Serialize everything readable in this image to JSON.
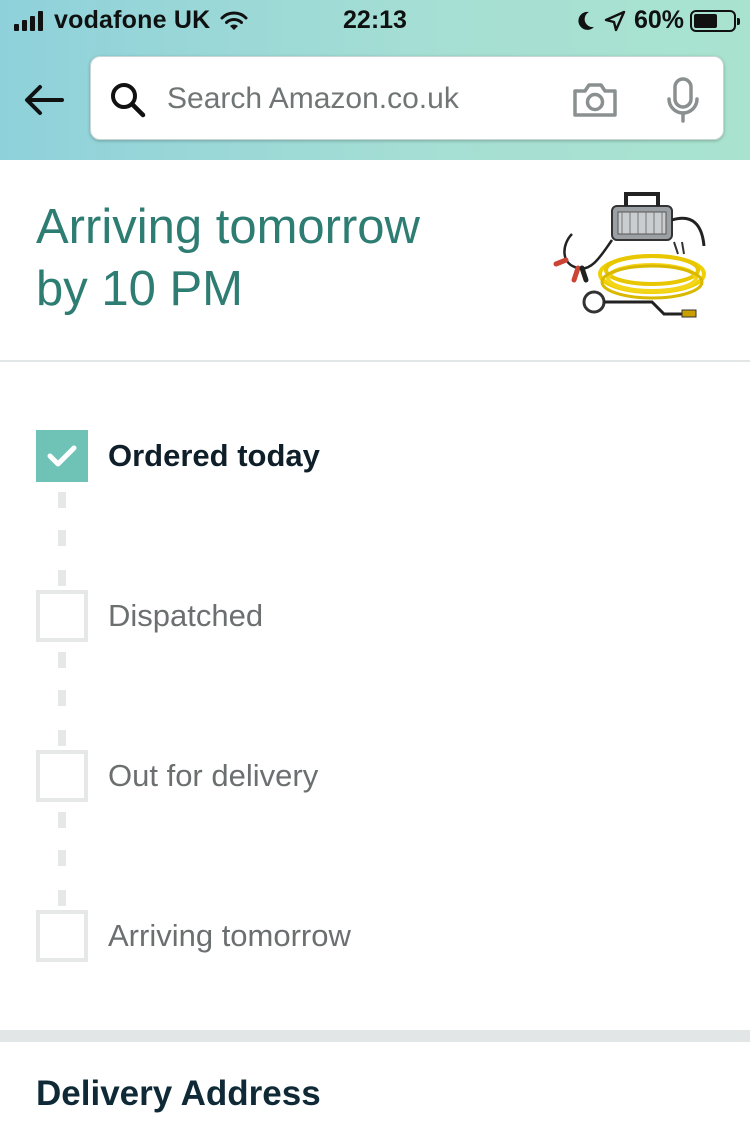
{
  "status_bar": {
    "carrier": "vodafone UK",
    "time": "22:13",
    "battery_percent": "60%"
  },
  "search": {
    "placeholder": "Search Amazon.co.uk"
  },
  "icons": {
    "back": "back-arrow-icon",
    "search": "search-icon",
    "camera": "camera-icon",
    "mic": "microphone-icon"
  },
  "arrival": {
    "line1": "Arriving tomorrow",
    "line2": "by 10 PM"
  },
  "tracking": {
    "steps": [
      {
        "label": "Ordered today",
        "completed": true
      },
      {
        "label": "Dispatched",
        "completed": false
      },
      {
        "label": "Out for delivery",
        "completed": false
      },
      {
        "label": "Arriving tomorrow",
        "completed": false
      }
    ]
  },
  "sections": {
    "delivery_address": "Delivery Address"
  },
  "colors": {
    "accent": "#2e7d73",
    "check_fill": "#6fc3b6",
    "header_start": "#8fd1db",
    "header_end": "#a9e3cf"
  }
}
